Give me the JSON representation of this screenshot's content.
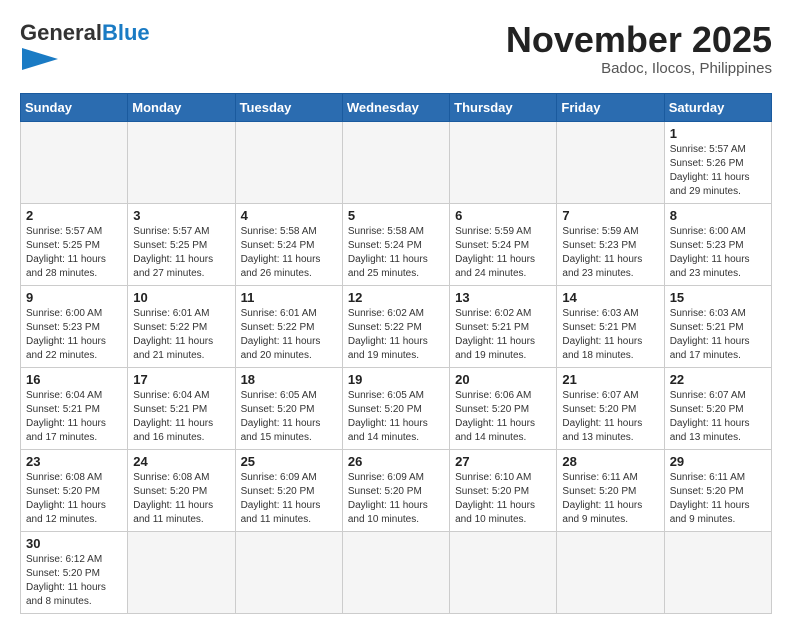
{
  "header": {
    "logo_general": "General",
    "logo_blue": "Blue",
    "month_title": "November 2025",
    "location": "Badoc, Ilocos, Philippines"
  },
  "weekdays": [
    "Sunday",
    "Monday",
    "Tuesday",
    "Wednesday",
    "Thursday",
    "Friday",
    "Saturday"
  ],
  "weeks": [
    [
      {
        "day": "",
        "info": ""
      },
      {
        "day": "",
        "info": ""
      },
      {
        "day": "",
        "info": ""
      },
      {
        "day": "",
        "info": ""
      },
      {
        "day": "",
        "info": ""
      },
      {
        "day": "",
        "info": ""
      },
      {
        "day": "1",
        "info": "Sunrise: 5:57 AM\nSunset: 5:26 PM\nDaylight: 11 hours\nand 29 minutes."
      }
    ],
    [
      {
        "day": "2",
        "info": "Sunrise: 5:57 AM\nSunset: 5:25 PM\nDaylight: 11 hours\nand 28 minutes."
      },
      {
        "day": "3",
        "info": "Sunrise: 5:57 AM\nSunset: 5:25 PM\nDaylight: 11 hours\nand 27 minutes."
      },
      {
        "day": "4",
        "info": "Sunrise: 5:58 AM\nSunset: 5:24 PM\nDaylight: 11 hours\nand 26 minutes."
      },
      {
        "day": "5",
        "info": "Sunrise: 5:58 AM\nSunset: 5:24 PM\nDaylight: 11 hours\nand 25 minutes."
      },
      {
        "day": "6",
        "info": "Sunrise: 5:59 AM\nSunset: 5:24 PM\nDaylight: 11 hours\nand 24 minutes."
      },
      {
        "day": "7",
        "info": "Sunrise: 5:59 AM\nSunset: 5:23 PM\nDaylight: 11 hours\nand 23 minutes."
      },
      {
        "day": "8",
        "info": "Sunrise: 6:00 AM\nSunset: 5:23 PM\nDaylight: 11 hours\nand 23 minutes."
      }
    ],
    [
      {
        "day": "9",
        "info": "Sunrise: 6:00 AM\nSunset: 5:23 PM\nDaylight: 11 hours\nand 22 minutes."
      },
      {
        "day": "10",
        "info": "Sunrise: 6:01 AM\nSunset: 5:22 PM\nDaylight: 11 hours\nand 21 minutes."
      },
      {
        "day": "11",
        "info": "Sunrise: 6:01 AM\nSunset: 5:22 PM\nDaylight: 11 hours\nand 20 minutes."
      },
      {
        "day": "12",
        "info": "Sunrise: 6:02 AM\nSunset: 5:22 PM\nDaylight: 11 hours\nand 19 minutes."
      },
      {
        "day": "13",
        "info": "Sunrise: 6:02 AM\nSunset: 5:21 PM\nDaylight: 11 hours\nand 19 minutes."
      },
      {
        "day": "14",
        "info": "Sunrise: 6:03 AM\nSunset: 5:21 PM\nDaylight: 11 hours\nand 18 minutes."
      },
      {
        "day": "15",
        "info": "Sunrise: 6:03 AM\nSunset: 5:21 PM\nDaylight: 11 hours\nand 17 minutes."
      }
    ],
    [
      {
        "day": "16",
        "info": "Sunrise: 6:04 AM\nSunset: 5:21 PM\nDaylight: 11 hours\nand 17 minutes."
      },
      {
        "day": "17",
        "info": "Sunrise: 6:04 AM\nSunset: 5:21 PM\nDaylight: 11 hours\nand 16 minutes."
      },
      {
        "day": "18",
        "info": "Sunrise: 6:05 AM\nSunset: 5:20 PM\nDaylight: 11 hours\nand 15 minutes."
      },
      {
        "day": "19",
        "info": "Sunrise: 6:05 AM\nSunset: 5:20 PM\nDaylight: 11 hours\nand 14 minutes."
      },
      {
        "day": "20",
        "info": "Sunrise: 6:06 AM\nSunset: 5:20 PM\nDaylight: 11 hours\nand 14 minutes."
      },
      {
        "day": "21",
        "info": "Sunrise: 6:07 AM\nSunset: 5:20 PM\nDaylight: 11 hours\nand 13 minutes."
      },
      {
        "day": "22",
        "info": "Sunrise: 6:07 AM\nSunset: 5:20 PM\nDaylight: 11 hours\nand 13 minutes."
      }
    ],
    [
      {
        "day": "23",
        "info": "Sunrise: 6:08 AM\nSunset: 5:20 PM\nDaylight: 11 hours\nand 12 minutes."
      },
      {
        "day": "24",
        "info": "Sunrise: 6:08 AM\nSunset: 5:20 PM\nDaylight: 11 hours\nand 11 minutes."
      },
      {
        "day": "25",
        "info": "Sunrise: 6:09 AM\nSunset: 5:20 PM\nDaylight: 11 hours\nand 11 minutes."
      },
      {
        "day": "26",
        "info": "Sunrise: 6:09 AM\nSunset: 5:20 PM\nDaylight: 11 hours\nand 10 minutes."
      },
      {
        "day": "27",
        "info": "Sunrise: 6:10 AM\nSunset: 5:20 PM\nDaylight: 11 hours\nand 10 minutes."
      },
      {
        "day": "28",
        "info": "Sunrise: 6:11 AM\nSunset: 5:20 PM\nDaylight: 11 hours\nand 9 minutes."
      },
      {
        "day": "29",
        "info": "Sunrise: 6:11 AM\nSunset: 5:20 PM\nDaylight: 11 hours\nand 9 minutes."
      }
    ],
    [
      {
        "day": "30",
        "info": "Sunrise: 6:12 AM\nSunset: 5:20 PM\nDaylight: 11 hours\nand 8 minutes."
      },
      {
        "day": "",
        "info": ""
      },
      {
        "day": "",
        "info": ""
      },
      {
        "day": "",
        "info": ""
      },
      {
        "day": "",
        "info": ""
      },
      {
        "day": "",
        "info": ""
      },
      {
        "day": "",
        "info": ""
      }
    ]
  ]
}
